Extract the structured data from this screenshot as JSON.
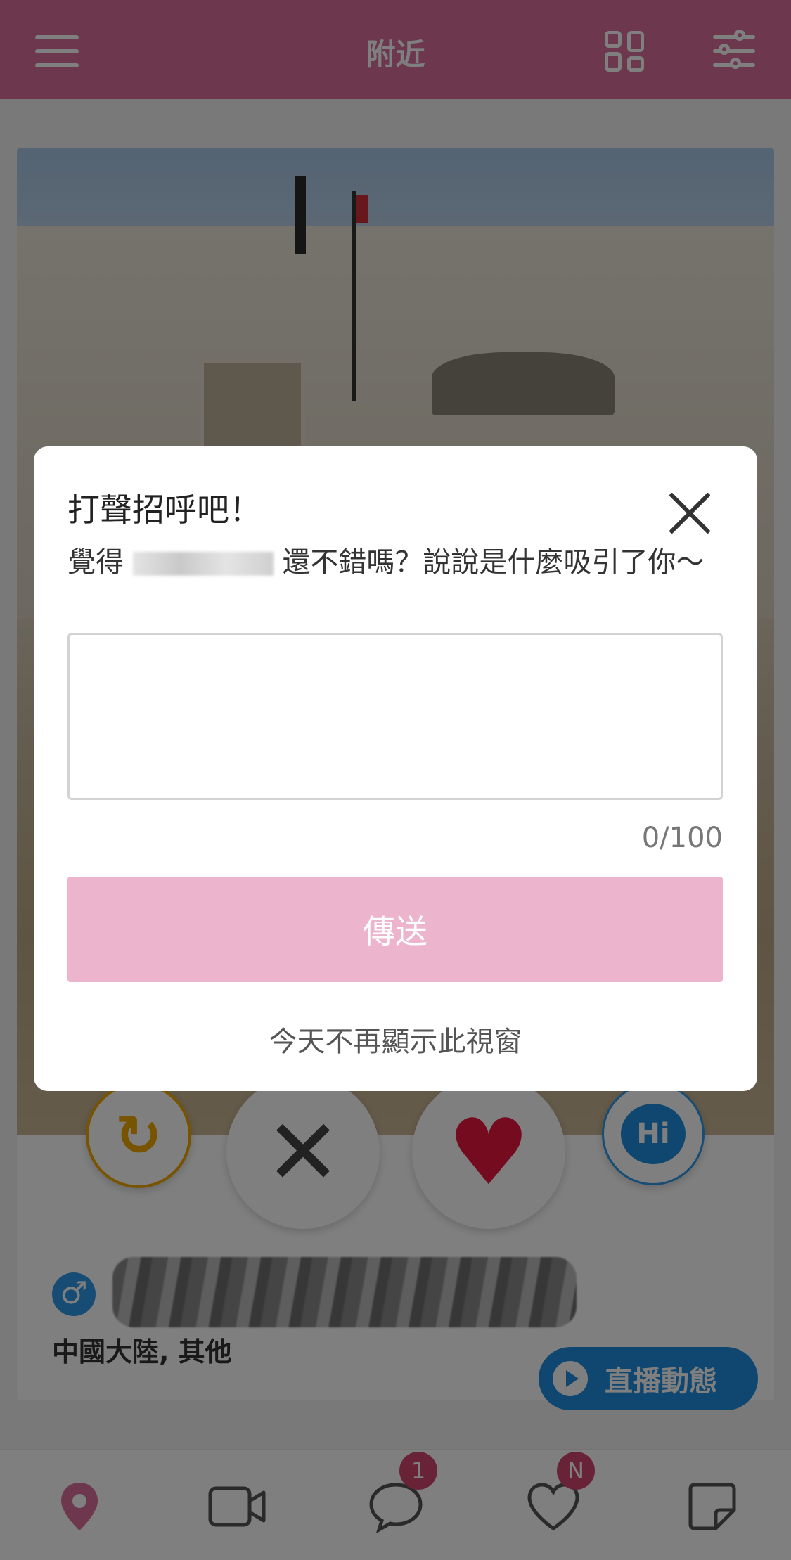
{
  "header": {
    "title": "附近",
    "icons": [
      "menu-icon",
      "grid-icon",
      "filter-icon"
    ]
  },
  "profile": {
    "location": "中國大陸, 其他",
    "live_button_label": "直播動態"
  },
  "actions": {
    "hi_label": "Hi"
  },
  "bottom_nav": {
    "items": [
      {
        "icon": "location-pin-icon",
        "active": true
      },
      {
        "icon": "video-icon"
      },
      {
        "icon": "chat-icon",
        "badge": "1"
      },
      {
        "icon": "heart-icon",
        "badge": "N"
      },
      {
        "icon": "note-icon"
      }
    ]
  },
  "modal": {
    "title": "打聲招呼吧！",
    "desc_prefix": "覺得",
    "desc_suffix": "還不錯嗎？說說是什麼吸引了你～",
    "input_value": "",
    "char_count": "0/100",
    "send_label": "傳送",
    "dont_show_label": "今天不再顯示此視窗"
  },
  "colors": {
    "header": "#db6f9c",
    "send_button": "#edb4cd",
    "badge": "#d0476e",
    "hi_blue": "#1e8fe1",
    "like_red": "#e8163c",
    "redo_orange": "#f0a800"
  }
}
